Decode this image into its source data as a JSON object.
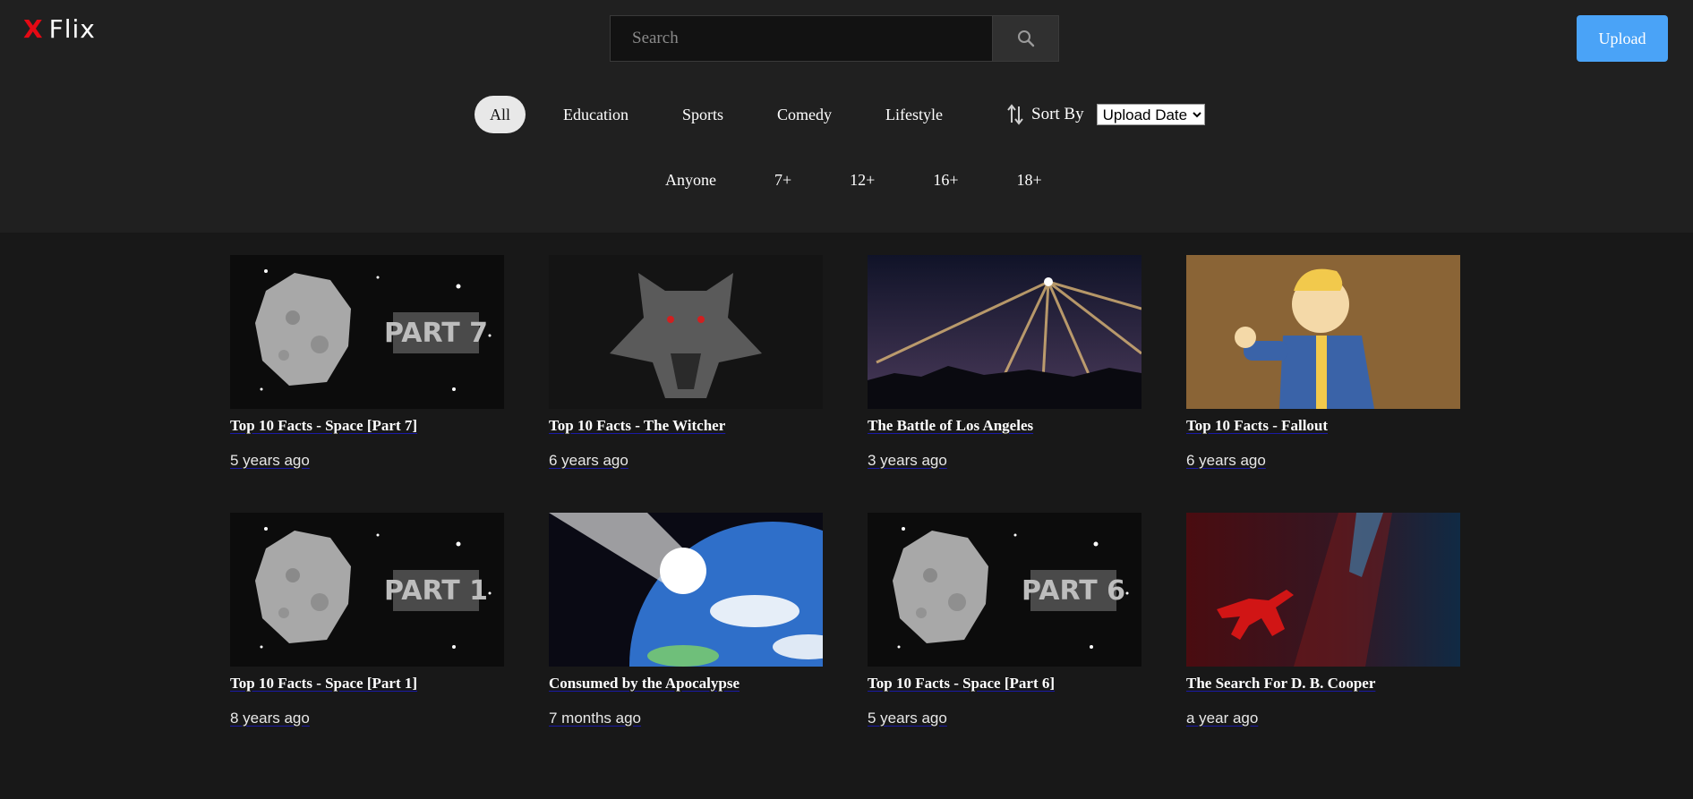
{
  "app": {
    "logo_x": "X",
    "logo_text": "Flix"
  },
  "search": {
    "placeholder": "Search",
    "icon": "search-icon"
  },
  "upload_label": "Upload",
  "genres": [
    {
      "label": "All",
      "active": true
    },
    {
      "label": "Education",
      "active": false
    },
    {
      "label": "Sports",
      "active": false
    },
    {
      "label": "Comedy",
      "active": false
    },
    {
      "label": "Lifestyle",
      "active": false
    }
  ],
  "sort": {
    "label": "Sort By",
    "icon": "sort-arrows-icon",
    "selected": "Upload Date"
  },
  "ages": [
    "Anyone",
    "7+",
    "12+",
    "16+",
    "18+"
  ],
  "videos": [
    {
      "title": "Top 10 Facts - Space [Part 7]",
      "ago": "5 years ago",
      "thumb": "moon",
      "thumb_text": "PART 7"
    },
    {
      "title": "Top 10 Facts - The Witcher",
      "ago": "6 years ago",
      "thumb": "wolf"
    },
    {
      "title": "The Battle of Los Angeles",
      "ago": "3 years ago",
      "thumb": "searchlights"
    },
    {
      "title": "Top 10 Facts - Fallout",
      "ago": "6 years ago",
      "thumb": "vaultboy"
    },
    {
      "title": "Top 10 Facts - Space [Part 1]",
      "ago": "8 years ago",
      "thumb": "moon",
      "thumb_text": "PART 1"
    },
    {
      "title": "Consumed by the Apocalypse",
      "ago": "7 months ago",
      "thumb": "earth"
    },
    {
      "title": "Top 10 Facts - Space [Part 6]",
      "ago": "5 years ago",
      "thumb": "moon",
      "thumb_text": "PART 6"
    },
    {
      "title": "The Search For D. B. Cooper",
      "ago": "a year ago",
      "thumb": "cooper"
    }
  ],
  "colors": {
    "header_bg": "#202020",
    "page_bg": "#181818",
    "accent": "#4aa3f7",
    "logo_red": "#e50914"
  }
}
